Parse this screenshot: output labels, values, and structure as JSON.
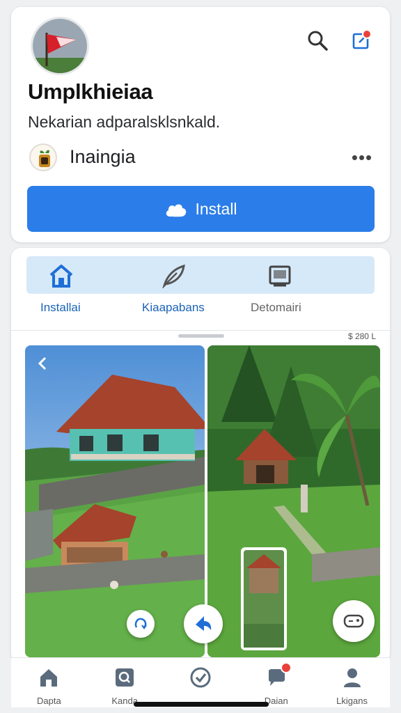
{
  "app": {
    "title": "Umplkhieiaa",
    "subtitle": "Nekarian adparalsklsnkald.",
    "developer": "Inaingia",
    "more": "•••",
    "install_label": "Install"
  },
  "tabs": [
    {
      "label": "Installai",
      "icon": "home-icon"
    },
    {
      "label": "Kiaapabans",
      "icon": "leaf-icon"
    },
    {
      "label": "Detomairi",
      "icon": "screen-icon"
    }
  ],
  "screenshots": {
    "size_label": "$ 280 L",
    "items": [
      "hillside-house-screenshot",
      "garden-shrine-screenshot"
    ]
  },
  "nav": [
    {
      "label": "Dapta",
      "icon": "home-icon"
    },
    {
      "label": "Kanda",
      "icon": "search-icon"
    },
    {
      "label": "",
      "icon": "check-icon"
    },
    {
      "label": "Daian",
      "icon": "chat-icon"
    },
    {
      "label": "Lkigans",
      "icon": "person-icon"
    }
  ],
  "colors": {
    "accent": "#2b7de9",
    "tab_bar_bg": "#d6e9f8",
    "badge": "#e8413c",
    "background": "#eef0f2"
  }
}
